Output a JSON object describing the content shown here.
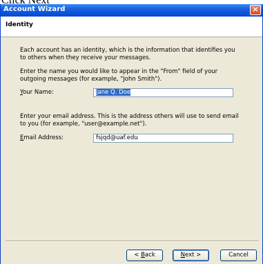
{
  "caption": "Click Next",
  "window": {
    "title": "Account Wizard",
    "close_glyph": "×"
  },
  "header": {
    "title": "Identity"
  },
  "content": {
    "intro": "Each account has an identity, which is the information that identifies you to others when they receive your messages.",
    "name_instructions": "Enter the name you would like to appear in the \"From\" field of your outgoing messages (for example, \"John Smith\").",
    "name_label": {
      "accel": "Y",
      "rest": "our Name:"
    },
    "name_value": "Jane Q. Doe",
    "email_instructions": "Enter your email address. This is the address others will use to send email to you (for example, \"user@example.net\").",
    "email_label": {
      "accel": "E",
      "rest": "mail Address:"
    },
    "email_value": "fsjqd@uaf.edu"
  },
  "buttons": {
    "back": {
      "pre": "< ",
      "accel": "B",
      "post": "ack"
    },
    "next": {
      "accel": "N",
      "post": "ext >"
    },
    "cancel": "Cancel"
  }
}
